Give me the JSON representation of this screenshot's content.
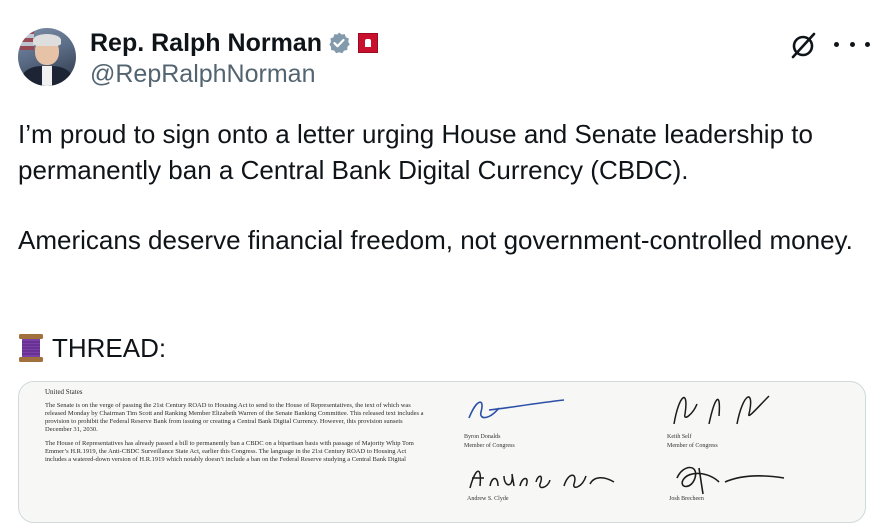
{
  "post": {
    "author_name": "Rep. Ralph Norman",
    "handle": "@RepRalphNorman",
    "paragraphs": [
      "I’m proud to sign onto a letter urging House and Senate leadership to permanently ban a Central Bank Digital Currency (CBDC).",
      "Americans deserve financial freedom, not government-controlled money."
    ],
    "thread_label": "THREAD:",
    "icons": {
      "verified": "verified-badge-icon",
      "affiliation": "government-affiliation-icon",
      "grok": "grok-icon",
      "more": "more-options-icon",
      "thread": "spool-of-thread-icon"
    }
  },
  "document": {
    "heading": "United States",
    "paragraph_1": "The Senate is on the verge of passing the 21st Century ROAD to Housing Act to send to the House of Representatives, the text of which was released Monday by Chairman Tim Scott and Ranking Member Elizabeth Warren of the Senate Banking Committee. This released text includes a provision to prohibit the Federal Reserve Bank from issuing or creating a Central Bank Digital Currency. However, this provision sunsets December 31, 2030.",
    "paragraph_2": "The House of Representatives has already passed a bill to permanently ban a CBDC on a bipartisan basis with passage of Majority Whip Tom Emmer’s H.R.1919, the Anti-CBDC Surveillance State Act, earlier this Congress. The language in the 21st Century ROAD to Housing Act includes a watered-down version of H.R.1919 which notably doesn’t include a ban on the Federal Reserve studying a Central Bank Digital",
    "signatures": [
      {
        "name": "Byron Donalds",
        "title": "Member of Congress"
      },
      {
        "name": "Keith Self",
        "title": "Member of Congress"
      },
      {
        "name": "Andrew S. Clyde",
        "title": ""
      },
      {
        "name": "Josh Brecheen",
        "title": ""
      }
    ]
  },
  "colors": {
    "text": "#0f1419",
    "secondary": "#536471",
    "verified_gray": "#829aab",
    "affiliation_red": "#c8102e",
    "border": "#cfd9de"
  }
}
